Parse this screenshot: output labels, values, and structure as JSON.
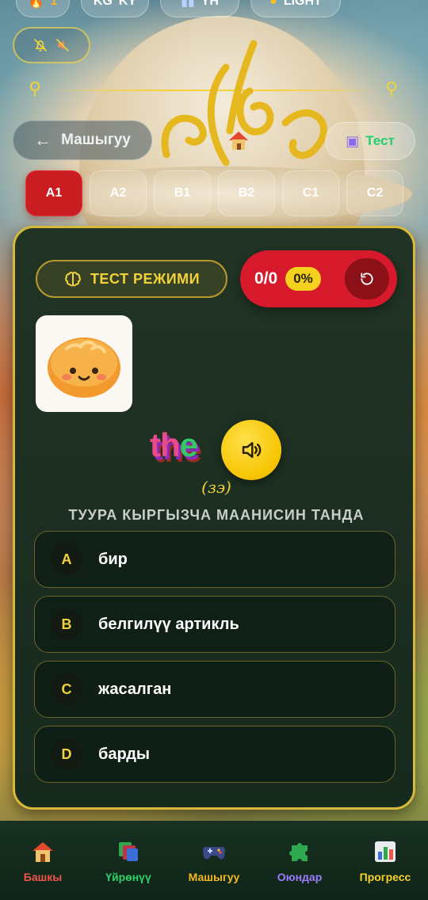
{
  "top_chips": {
    "fire_count": "1",
    "lang_code": "KG",
    "lang_code2": "KY",
    "words_label": "YH",
    "theme_label": "LIGHT"
  },
  "nav": {
    "back_label": "Машыгуу",
    "test_label": "Тест"
  },
  "levels": [
    "A1",
    "A2",
    "B1",
    "B2",
    "C1",
    "C2"
  ],
  "active_level": "A1",
  "card": {
    "mode_label": "ТЕСТ РЕЖИМИ",
    "score": "0/0",
    "percent": "0%",
    "word_parts": [
      "th",
      "e",
      ""
    ],
    "word": "the",
    "transcription": "(зэ)",
    "prompt": "ТУУРА КЫРГЫЗЧА МААНИСИН ТАНДА",
    "options": [
      {
        "letter": "A",
        "text": "бир"
      },
      {
        "letter": "B",
        "text": "белгилүү артикль"
      },
      {
        "letter": "C",
        "text": "жасалган"
      },
      {
        "letter": "D",
        "text": "барды"
      }
    ]
  },
  "bottom_nav": [
    {
      "label": "Башкы",
      "color": "#f0554a",
      "icon": "house-icon"
    },
    {
      "label": "Үйрөнүү",
      "color": "#2fd06a",
      "icon": "cards-icon"
    },
    {
      "label": "Машыгуу",
      "color": "#f5b820",
      "icon": "gamepad-icon"
    },
    {
      "label": "Оюндар",
      "color": "#9b7cff",
      "icon": "puzzle-icon"
    },
    {
      "label": "Прогресс",
      "color": "#f7d22a",
      "icon": "bar-chart-icon"
    }
  ],
  "colors": {
    "accent_red": "#c91d22",
    "gold": "#d8b83a",
    "card_bg": "#1b2d20"
  }
}
